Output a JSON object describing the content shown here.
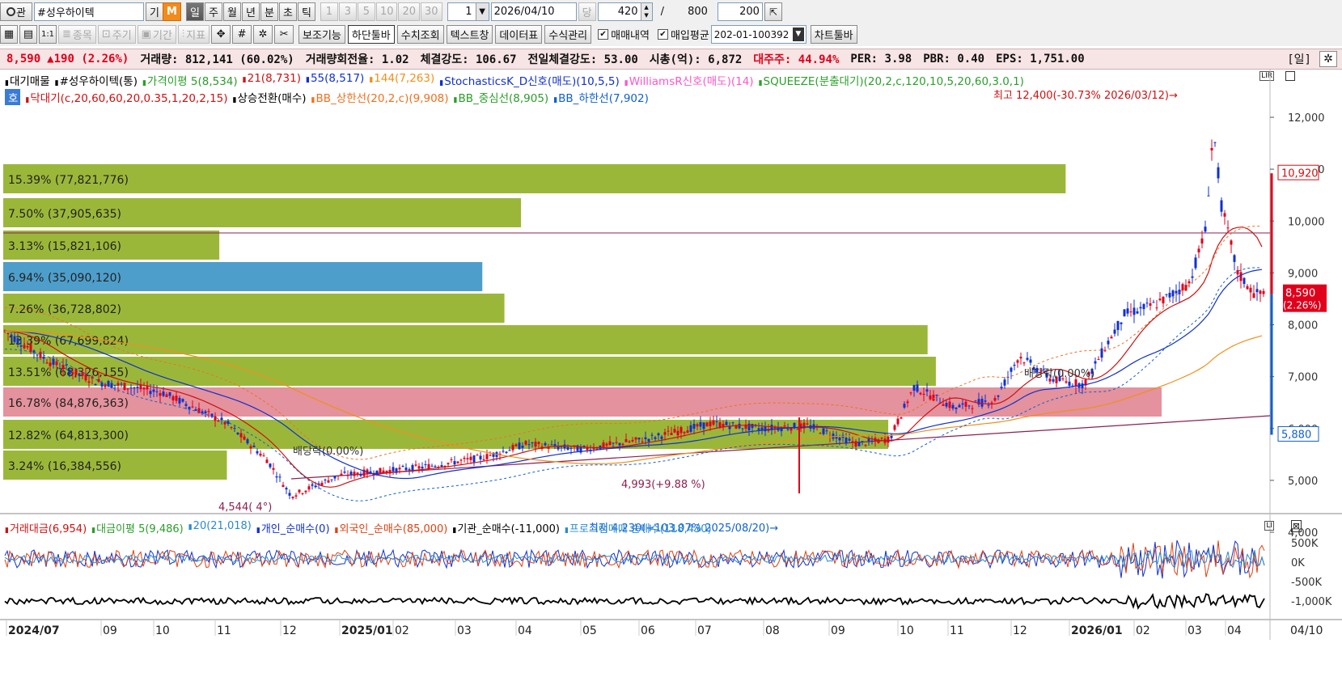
{
  "toolbar1": {
    "search_icon": "search-icon",
    "search_label": "관",
    "stock_name": "#성우하이텍",
    "btn_gi": "기",
    "btn_m": "M",
    "periods": [
      "일",
      "주",
      "월",
      "년",
      "분",
      "초",
      "틱"
    ],
    "active_period": "일",
    "intervals": [
      "1",
      "3",
      "5",
      "10",
      "20",
      "30"
    ],
    "interval_value": "1",
    "date": "2026/04/10",
    "dang": "당",
    "count": "420",
    "slash": "/",
    "total": "800",
    "view_count": "200"
  },
  "toolbar2": {
    "btn_jongmok": "종목",
    "btn_jugi": "주기",
    "btn_gigan": "기간",
    "btn_jipyo": "지표",
    "buttons": [
      "보조기능",
      "하단툴바",
      "수치조회",
      "텍스트창",
      "데이터표",
      "수식관리"
    ],
    "active_button": "하단툴바",
    "chk_trade": "매매내역",
    "chk_avg": "매입평균",
    "account": "202-01-100392",
    "chart_toolbar": "차트툴바"
  },
  "infobar": {
    "price": "8,590",
    "change": "▲190",
    "change_pct": "(2.26%)",
    "volume": "거래량: 812,141",
    "volume_pct": "(60.02%)",
    "turnover": "거래량회전율: 1.02",
    "strength": "체결강도: 106.67",
    "prev_strength": "전일체결강도: 53.00",
    "market_cap": "시총(억): 6,872",
    "major_holder": "대주주: 44.94%",
    "per": "PER: 3.98",
    "pbr": "PBR: 0.40",
    "eps": "EPS: 1,751.00",
    "period_tag": "[일]"
  },
  "legend1": [
    {
      "text": "대기매물",
      "color": "#000000"
    },
    {
      "text": "#성우하이텍(통)",
      "color": "#000000"
    },
    {
      "text": "가격이평 5(8,534)",
      "color": "#2a9d2a"
    },
    {
      "text": "21(8,731)",
      "color": "#d01010"
    },
    {
      "text": "55(8,517)",
      "color": "#1030d0"
    },
    {
      "text": "144(7,263)",
      "color": "#f0901a"
    },
    {
      "text": "StochasticsK_D신호(매도)(10,5,5)",
      "color": "#1030d0"
    },
    {
      "text": "WilliamsR신호(매도)(14)",
      "color": "#ff55cc"
    },
    {
      "text": "SQUEEZE(분출대기)(20,2,c,120,10,5,20,60,3.0,1)",
      "color": "#2aa02a"
    }
  ],
  "legend2": [
    {
      "text": "호",
      "color": "#ffffff"
    },
    {
      "text": "닥대기(c,20,60,60,20,0.35,1,20,2,15)",
      "color": "#d01010"
    },
    {
      "text": "상승전환(매수)",
      "color": "#000000"
    },
    {
      "text": "BB_상한선(20,2,c)(9,908)",
      "color": "#f07020"
    },
    {
      "text": "BB_중심선(8,905)",
      "color": "#2a9d2a"
    },
    {
      "text": "BB_하한선(7,902)",
      "color": "#1060d0"
    }
  ],
  "volume_profile": [
    {
      "label": "15.39% (77,821,776)",
      "share": 0.1539,
      "color": "#96b32f"
    },
    {
      "label": "7.50% (37,905,635)",
      "share": 0.075,
      "color": "#96b32f"
    },
    {
      "label": "3.13% (15,821,106)",
      "share": 0.0313,
      "color": "#96b32f"
    },
    {
      "label": "6.94% (35,090,120)",
      "share": 0.0694,
      "color": "#4499c8"
    },
    {
      "label": "7.26% (36,728,802)",
      "share": 0.0726,
      "color": "#96b32f"
    },
    {
      "label": "13.39% (67,699,824)",
      "share": 0.1339,
      "color": "#96b32f"
    },
    {
      "label": "13.51% (68,326,155)",
      "share": 0.1351,
      "color": "#96b32f"
    },
    {
      "label": "16.78% (84,876,363)",
      "share": 0.1678,
      "color": "#e38c98"
    },
    {
      "label": "12.82% (64,813,300)",
      "share": 0.1282,
      "color": "#96b32f"
    },
    {
      "label": "3.24% (16,384,556)",
      "share": 0.0324,
      "color": "#96b32f"
    }
  ],
  "annotations": {
    "high": "최고 12,400(-30.73% 2026/03/12)→",
    "low": "최저 4,230(+103.07% 2025/08/20)→",
    "mid": "4,993(+9.88 %)",
    "left_low": "4,544( 4°)",
    "div1": "배당락(0.00%)",
    "div2": "배당락(0.00%)"
  },
  "price_axis": {
    "ticks": [
      "12,000",
      "11,000",
      "10,000",
      "9,000",
      "8,000",
      "7,000",
      "6,000",
      "5,000",
      "4,000"
    ],
    "current_label": "8,590",
    "current_pct": "(2.26%)",
    "top_box": "10,920",
    "bottom_box": "5,880"
  },
  "lower_legend": [
    {
      "text": "거래대금(6,954)",
      "color": "#d01010"
    },
    {
      "text": "대금이평 5(9,486)",
      "color": "#2a9d2a"
    },
    {
      "text": "20(21,018)",
      "color": "#2a8ad0"
    },
    {
      "text": "개인_순매수(0)",
      "color": "#1030d0"
    },
    {
      "text": "외국인_순매수(85,000)",
      "color": "#e04010"
    },
    {
      "text": "기관_순매수(-11,000)",
      "color": "#000000"
    },
    {
      "text": "프로그램매매 순매수(118,430)",
      "color": "#2a8ad0"
    }
  ],
  "lower_axis": {
    "ticks": [
      "500K",
      "0K",
      "-500K",
      "-1,000K"
    ]
  },
  "time_axis": {
    "labels": [
      "2024/07",
      "09",
      "10",
      "11",
      "12",
      "2025/01",
      "02",
      "03",
      "04",
      "05",
      "06",
      "07",
      "08",
      "09",
      "10",
      "11",
      "12",
      "2026/01",
      "02",
      "03",
      "04"
    ],
    "end_label": "04/10"
  },
  "colors": {
    "up": "#e0001b",
    "down": "#1030d0",
    "ma5": "#2a9d2a",
    "ma21": "#d01010",
    "ma55": "#1030d0",
    "ma144": "#f0901a"
  }
}
